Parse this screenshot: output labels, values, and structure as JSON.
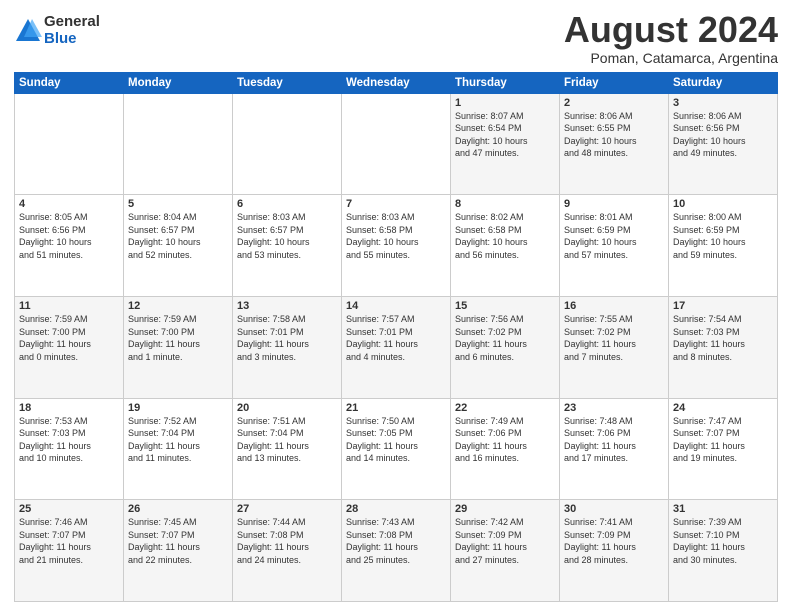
{
  "logo": {
    "general": "General",
    "blue": "Blue"
  },
  "title": "August 2024",
  "subtitle": "Poman, Catamarca, Argentina",
  "headers": [
    "Sunday",
    "Monday",
    "Tuesday",
    "Wednesday",
    "Thursday",
    "Friday",
    "Saturday"
  ],
  "weeks": [
    [
      {
        "day": "",
        "info": ""
      },
      {
        "day": "",
        "info": ""
      },
      {
        "day": "",
        "info": ""
      },
      {
        "day": "",
        "info": ""
      },
      {
        "day": "1",
        "info": "Sunrise: 8:07 AM\nSunset: 6:54 PM\nDaylight: 10 hours\nand 47 minutes."
      },
      {
        "day": "2",
        "info": "Sunrise: 8:06 AM\nSunset: 6:55 PM\nDaylight: 10 hours\nand 48 minutes."
      },
      {
        "day": "3",
        "info": "Sunrise: 8:06 AM\nSunset: 6:56 PM\nDaylight: 10 hours\nand 49 minutes."
      }
    ],
    [
      {
        "day": "4",
        "info": "Sunrise: 8:05 AM\nSunset: 6:56 PM\nDaylight: 10 hours\nand 51 minutes."
      },
      {
        "day": "5",
        "info": "Sunrise: 8:04 AM\nSunset: 6:57 PM\nDaylight: 10 hours\nand 52 minutes."
      },
      {
        "day": "6",
        "info": "Sunrise: 8:03 AM\nSunset: 6:57 PM\nDaylight: 10 hours\nand 53 minutes."
      },
      {
        "day": "7",
        "info": "Sunrise: 8:03 AM\nSunset: 6:58 PM\nDaylight: 10 hours\nand 55 minutes."
      },
      {
        "day": "8",
        "info": "Sunrise: 8:02 AM\nSunset: 6:58 PM\nDaylight: 10 hours\nand 56 minutes."
      },
      {
        "day": "9",
        "info": "Sunrise: 8:01 AM\nSunset: 6:59 PM\nDaylight: 10 hours\nand 57 minutes."
      },
      {
        "day": "10",
        "info": "Sunrise: 8:00 AM\nSunset: 6:59 PM\nDaylight: 10 hours\nand 59 minutes."
      }
    ],
    [
      {
        "day": "11",
        "info": "Sunrise: 7:59 AM\nSunset: 7:00 PM\nDaylight: 11 hours\nand 0 minutes."
      },
      {
        "day": "12",
        "info": "Sunrise: 7:59 AM\nSunset: 7:00 PM\nDaylight: 11 hours\nand 1 minute."
      },
      {
        "day": "13",
        "info": "Sunrise: 7:58 AM\nSunset: 7:01 PM\nDaylight: 11 hours\nand 3 minutes."
      },
      {
        "day": "14",
        "info": "Sunrise: 7:57 AM\nSunset: 7:01 PM\nDaylight: 11 hours\nand 4 minutes."
      },
      {
        "day": "15",
        "info": "Sunrise: 7:56 AM\nSunset: 7:02 PM\nDaylight: 11 hours\nand 6 minutes."
      },
      {
        "day": "16",
        "info": "Sunrise: 7:55 AM\nSunset: 7:02 PM\nDaylight: 11 hours\nand 7 minutes."
      },
      {
        "day": "17",
        "info": "Sunrise: 7:54 AM\nSunset: 7:03 PM\nDaylight: 11 hours\nand 8 minutes."
      }
    ],
    [
      {
        "day": "18",
        "info": "Sunrise: 7:53 AM\nSunset: 7:03 PM\nDaylight: 11 hours\nand 10 minutes."
      },
      {
        "day": "19",
        "info": "Sunrise: 7:52 AM\nSunset: 7:04 PM\nDaylight: 11 hours\nand 11 minutes."
      },
      {
        "day": "20",
        "info": "Sunrise: 7:51 AM\nSunset: 7:04 PM\nDaylight: 11 hours\nand 13 minutes."
      },
      {
        "day": "21",
        "info": "Sunrise: 7:50 AM\nSunset: 7:05 PM\nDaylight: 11 hours\nand 14 minutes."
      },
      {
        "day": "22",
        "info": "Sunrise: 7:49 AM\nSunset: 7:06 PM\nDaylight: 11 hours\nand 16 minutes."
      },
      {
        "day": "23",
        "info": "Sunrise: 7:48 AM\nSunset: 7:06 PM\nDaylight: 11 hours\nand 17 minutes."
      },
      {
        "day": "24",
        "info": "Sunrise: 7:47 AM\nSunset: 7:07 PM\nDaylight: 11 hours\nand 19 minutes."
      }
    ],
    [
      {
        "day": "25",
        "info": "Sunrise: 7:46 AM\nSunset: 7:07 PM\nDaylight: 11 hours\nand 21 minutes."
      },
      {
        "day": "26",
        "info": "Sunrise: 7:45 AM\nSunset: 7:07 PM\nDaylight: 11 hours\nand 22 minutes."
      },
      {
        "day": "27",
        "info": "Sunrise: 7:44 AM\nSunset: 7:08 PM\nDaylight: 11 hours\nand 24 minutes."
      },
      {
        "day": "28",
        "info": "Sunrise: 7:43 AM\nSunset: 7:08 PM\nDaylight: 11 hours\nand 25 minutes."
      },
      {
        "day": "29",
        "info": "Sunrise: 7:42 AM\nSunset: 7:09 PM\nDaylight: 11 hours\nand 27 minutes."
      },
      {
        "day": "30",
        "info": "Sunrise: 7:41 AM\nSunset: 7:09 PM\nDaylight: 11 hours\nand 28 minutes."
      },
      {
        "day": "31",
        "info": "Sunrise: 7:39 AM\nSunset: 7:10 PM\nDaylight: 11 hours\nand 30 minutes."
      }
    ]
  ]
}
